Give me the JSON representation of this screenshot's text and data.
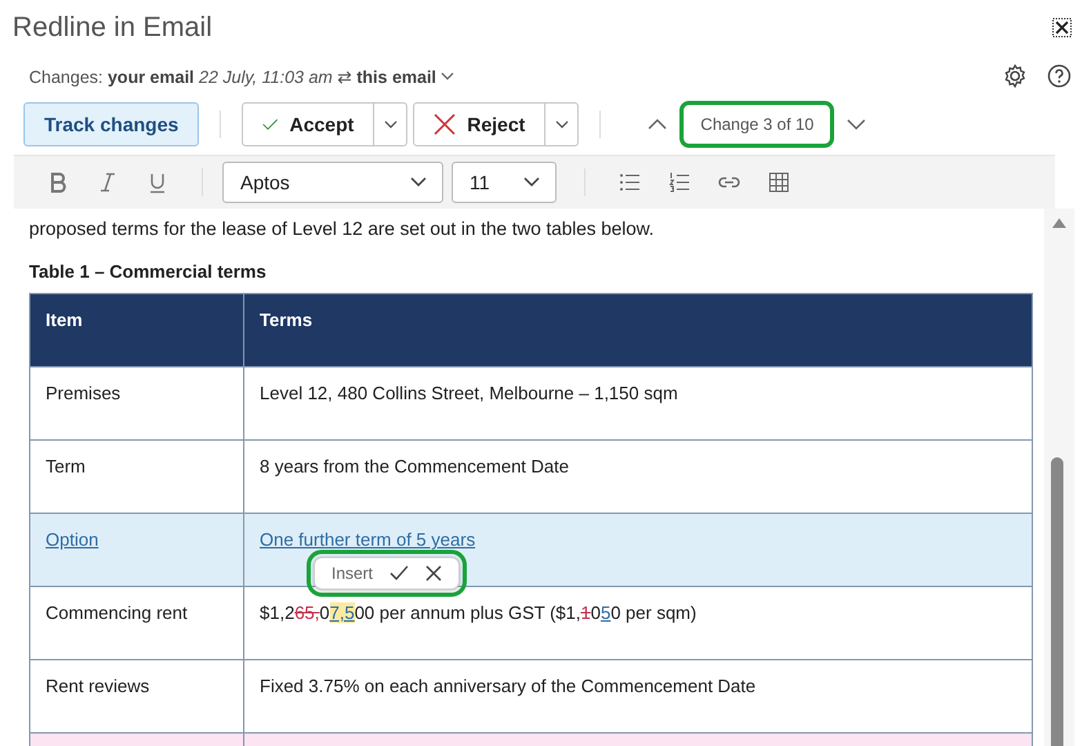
{
  "window": {
    "title": "Redline in Email"
  },
  "changes_line": {
    "label": "Changes:",
    "from": "your email",
    "date": "22 July, 11:03 am",
    "swap": "⇄",
    "to": "this email"
  },
  "toolbar": {
    "track_changes": {
      "label": "Track changes",
      "on": true
    },
    "accept": "Accept",
    "reject": "Reject",
    "counter": {
      "text": "Change 3 of 10",
      "highlighted": true
    }
  },
  "format_bar": {
    "font": "Aptos",
    "size": "11"
  },
  "document": {
    "paragraph": "proposed terms for the lease of Level 12 are set out in the two tables below.",
    "table_title": "Table 1 – Commercial terms",
    "table": {
      "columns": [
        "Item",
        "Terms"
      ],
      "rows": [
        {
          "inserted": false,
          "deleted": false,
          "item": [
            {
              "kind": "normal",
              "text": "Premises"
            }
          ],
          "terms": [
            {
              "kind": "normal",
              "text": "Level 12, 480 Collins Street, Melbourne – 1,150 sqm"
            }
          ]
        },
        {
          "inserted": false,
          "deleted": false,
          "item": [
            {
              "kind": "normal",
              "text": "Term"
            }
          ],
          "terms": [
            {
              "kind": "normal",
              "text": "8 years from the Commencement Date"
            }
          ]
        },
        {
          "inserted": true,
          "deleted": false,
          "item": [
            {
              "kind": "normal",
              "text": "Option"
            }
          ],
          "terms": [
            {
              "kind": "normal",
              "text": "One further term of 5 years"
            }
          ],
          "popup": {
            "label": "Insert",
            "highlighted": true
          }
        },
        {
          "inserted": false,
          "deleted": false,
          "item": [
            {
              "kind": "normal",
              "text": "Commencing rent"
            }
          ],
          "terms": [
            {
              "kind": "normal",
              "text": "$1,2"
            },
            {
              "kind": "deleted",
              "text": "65,"
            },
            {
              "kind": "normal",
              "text": "0"
            },
            {
              "kind": "inserted",
              "text": "7,5",
              "current": true
            },
            {
              "kind": "normal",
              "text": "00 per annum plus GST ($1,"
            },
            {
              "kind": "deleted",
              "text": "1"
            },
            {
              "kind": "normal",
              "text": "0"
            },
            {
              "kind": "inserted",
              "text": "5",
              "current": false
            },
            {
              "kind": "normal",
              "text": "0 per sqm)"
            }
          ]
        },
        {
          "inserted": false,
          "deleted": false,
          "item": [
            {
              "kind": "normal",
              "text": "Rent reviews"
            }
          ],
          "terms": [
            {
              "kind": "normal",
              "text": "Fixed 3.75% on each anniversary of the Commencement Date"
            }
          ]
        },
        {
          "inserted": false,
          "deleted": true,
          "item": [],
          "terms": []
        }
      ]
    }
  }
}
